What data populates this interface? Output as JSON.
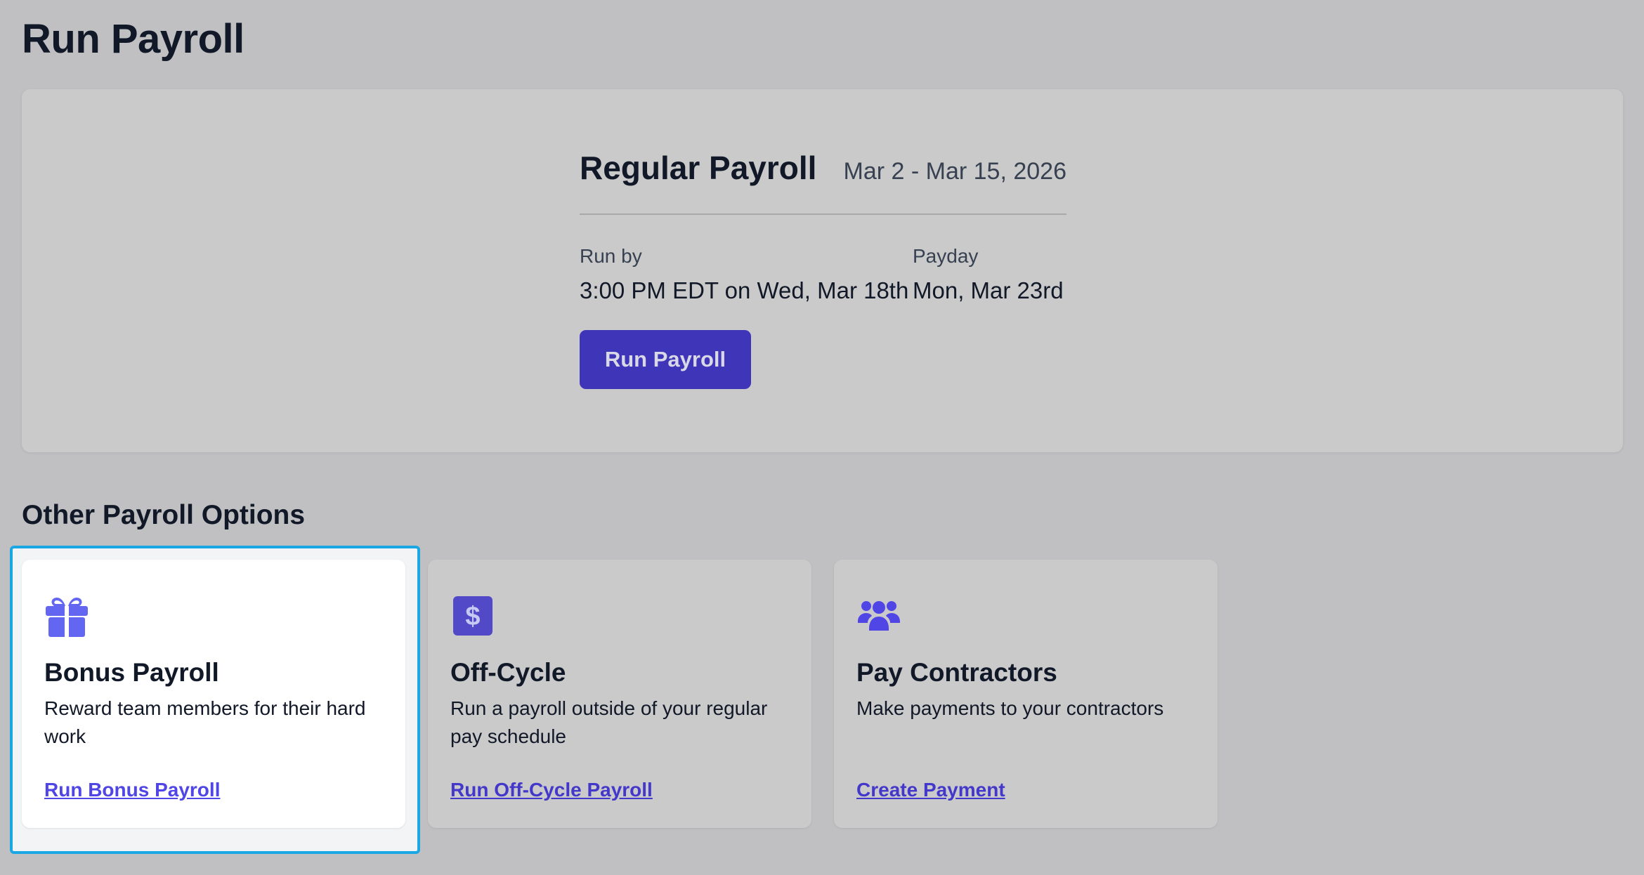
{
  "page": {
    "title": "Run Payroll"
  },
  "regular": {
    "title": "Regular Payroll",
    "range": "Mar 2 - Mar 15, 2026",
    "run_by_label": "Run by",
    "run_by_value": "3:00 PM EDT on Wed, Mar 18th",
    "payday_label": "Payday",
    "payday_value": "Mon, Mar 23rd",
    "button_label": "Run Payroll"
  },
  "other": {
    "title": "Other Payroll Options",
    "cards": [
      {
        "icon": "gift-icon",
        "title": "Bonus Payroll",
        "description": "Reward team members for their hard work",
        "link": "Run Bonus Payroll",
        "selected": true
      },
      {
        "icon": "dollar-icon",
        "title": "Off-Cycle",
        "description": "Run a payroll outside of your regular pay schedule",
        "link": "Run Off-Cycle Payroll",
        "selected": false
      },
      {
        "icon": "users-icon",
        "title": "Pay Contractors",
        "description": "Make payments to your contractors",
        "link": "Create Payment",
        "selected": false
      }
    ]
  },
  "colors": {
    "accent": "#4f46e5",
    "button": "#3f35b8",
    "selection_ring": "#1aa7e3",
    "background": "#c0c0c2"
  }
}
